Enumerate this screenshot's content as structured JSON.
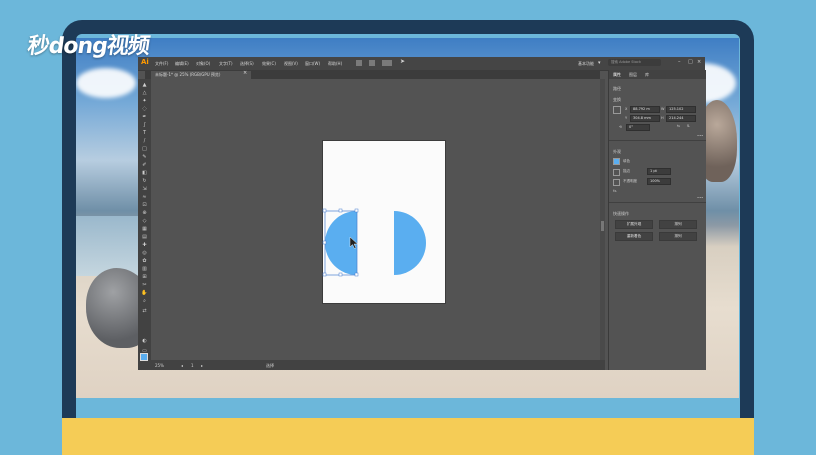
{
  "watermark": {
    "text": "秒d​ong视频"
  },
  "app": {
    "logo": "Ai",
    "menu": [
      "文件(F)",
      "编辑(E)",
      "对象(O)",
      "文字(T)",
      "选择(S)",
      "效果(C)",
      "视图(V)",
      "窗口(W)",
      "帮助(H)"
    ],
    "workspace": "基本功能",
    "search_placeholder": "搜索 Adobe Stock",
    "tab": {
      "title": "未标题-1* @ 25% (RGB/GPU 预览)",
      "close": "×"
    }
  },
  "status": {
    "zoom": "25%",
    "page": "1",
    "tool": "选择"
  },
  "panel": {
    "tabs": [
      "属性",
      "图层",
      "库"
    ],
    "sections": {
      "object": "路径",
      "transform": "变换",
      "appearance": "外观",
      "quick_actions": "快速操作"
    },
    "transform": {
      "x": "88.792 m",
      "y": "304.8 mm",
      "w": "125.102",
      "h": "214.244",
      "angle": "0°"
    },
    "appearance": {
      "fill_label": "填色",
      "stroke_label": "描边",
      "stroke_value": "1 pt",
      "opacity_label": "不透明度",
      "opacity_value": "100%",
      "fx": "fx."
    },
    "buttons": [
      "扩展外观",
      "排列",
      "重新着色",
      "排列"
    ]
  },
  "art": {
    "color": "#5aaef0"
  }
}
